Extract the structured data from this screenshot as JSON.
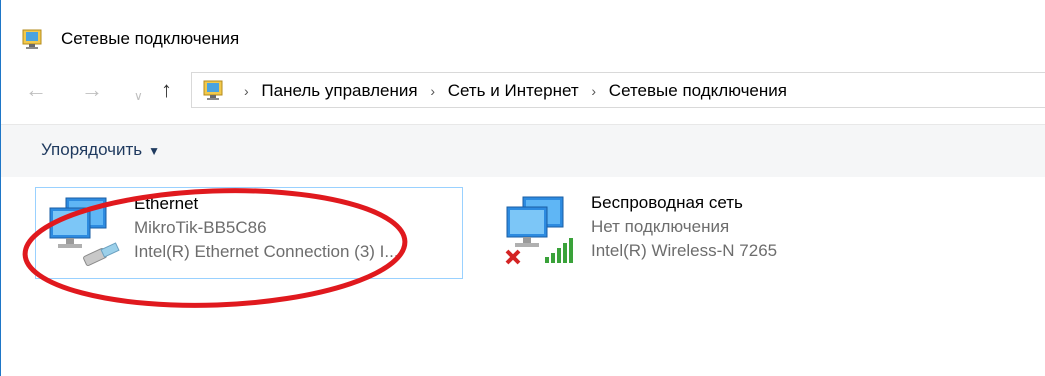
{
  "window": {
    "title": "Сетевые подключения",
    "title_icon": "network-connections-icon"
  },
  "navigation": {
    "back_icon": "back-arrow-icon",
    "forward_icon": "forward-arrow-icon",
    "recent_icon": "chevron-down-icon",
    "up_icon": "up-arrow-icon"
  },
  "breadcrumb": {
    "separator": "›",
    "items": [
      {
        "label": "Панель управления"
      },
      {
        "label": "Сеть и Интернет"
      },
      {
        "label": "Сетевые подключения"
      }
    ]
  },
  "commandbar": {
    "organize_label": "Упорядочить",
    "organize_caret": "▼"
  },
  "connections": [
    {
      "name": "Ethernet",
      "status": "MikroTik-BB5C86",
      "device": "Intel(R) Ethernet Connection (3) I...",
      "icon": "ethernet-adapter-icon",
      "selected": true
    },
    {
      "name": "Беспроводная сеть",
      "status": "Нет подключения",
      "device": "Intel(R) Wireless-N 7265",
      "icon": "wireless-adapter-icon",
      "selected": false
    }
  ],
  "colors": {
    "accent": "#1e76c7",
    "selection_border": "#99d1ff",
    "annotation": "#e0191e",
    "status_error": "#d42424",
    "signal": "#3aa23a"
  }
}
